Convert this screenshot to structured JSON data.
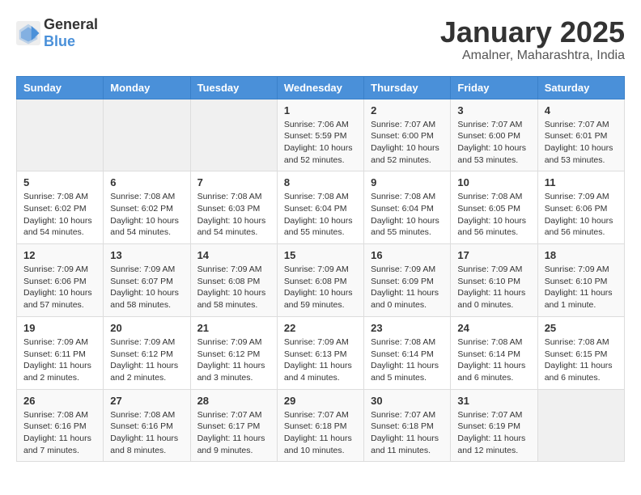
{
  "header": {
    "logo": {
      "text_general": "General",
      "text_blue": "Blue"
    },
    "title": "January 2025",
    "subtitle": "Amalner, Maharashtra, India"
  },
  "weekdays": [
    "Sunday",
    "Monday",
    "Tuesday",
    "Wednesday",
    "Thursday",
    "Friday",
    "Saturday"
  ],
  "weeks": [
    [
      {
        "day": "",
        "info": ""
      },
      {
        "day": "",
        "info": ""
      },
      {
        "day": "",
        "info": ""
      },
      {
        "day": "1",
        "info": "Sunrise: 7:06 AM\nSunset: 5:59 PM\nDaylight: 10 hours\nand 52 minutes."
      },
      {
        "day": "2",
        "info": "Sunrise: 7:07 AM\nSunset: 6:00 PM\nDaylight: 10 hours\nand 52 minutes."
      },
      {
        "day": "3",
        "info": "Sunrise: 7:07 AM\nSunset: 6:00 PM\nDaylight: 10 hours\nand 53 minutes."
      },
      {
        "day": "4",
        "info": "Sunrise: 7:07 AM\nSunset: 6:01 PM\nDaylight: 10 hours\nand 53 minutes."
      }
    ],
    [
      {
        "day": "5",
        "info": "Sunrise: 7:08 AM\nSunset: 6:02 PM\nDaylight: 10 hours\nand 54 minutes."
      },
      {
        "day": "6",
        "info": "Sunrise: 7:08 AM\nSunset: 6:02 PM\nDaylight: 10 hours\nand 54 minutes."
      },
      {
        "day": "7",
        "info": "Sunrise: 7:08 AM\nSunset: 6:03 PM\nDaylight: 10 hours\nand 54 minutes."
      },
      {
        "day": "8",
        "info": "Sunrise: 7:08 AM\nSunset: 6:04 PM\nDaylight: 10 hours\nand 55 minutes."
      },
      {
        "day": "9",
        "info": "Sunrise: 7:08 AM\nSunset: 6:04 PM\nDaylight: 10 hours\nand 55 minutes."
      },
      {
        "day": "10",
        "info": "Sunrise: 7:08 AM\nSunset: 6:05 PM\nDaylight: 10 hours\nand 56 minutes."
      },
      {
        "day": "11",
        "info": "Sunrise: 7:09 AM\nSunset: 6:06 PM\nDaylight: 10 hours\nand 56 minutes."
      }
    ],
    [
      {
        "day": "12",
        "info": "Sunrise: 7:09 AM\nSunset: 6:06 PM\nDaylight: 10 hours\nand 57 minutes."
      },
      {
        "day": "13",
        "info": "Sunrise: 7:09 AM\nSunset: 6:07 PM\nDaylight: 10 hours\nand 58 minutes."
      },
      {
        "day": "14",
        "info": "Sunrise: 7:09 AM\nSunset: 6:08 PM\nDaylight: 10 hours\nand 58 minutes."
      },
      {
        "day": "15",
        "info": "Sunrise: 7:09 AM\nSunset: 6:08 PM\nDaylight: 10 hours\nand 59 minutes."
      },
      {
        "day": "16",
        "info": "Sunrise: 7:09 AM\nSunset: 6:09 PM\nDaylight: 11 hours\nand 0 minutes."
      },
      {
        "day": "17",
        "info": "Sunrise: 7:09 AM\nSunset: 6:10 PM\nDaylight: 11 hours\nand 0 minutes."
      },
      {
        "day": "18",
        "info": "Sunrise: 7:09 AM\nSunset: 6:10 PM\nDaylight: 11 hours\nand 1 minute."
      }
    ],
    [
      {
        "day": "19",
        "info": "Sunrise: 7:09 AM\nSunset: 6:11 PM\nDaylight: 11 hours\nand 2 minutes."
      },
      {
        "day": "20",
        "info": "Sunrise: 7:09 AM\nSunset: 6:12 PM\nDaylight: 11 hours\nand 2 minutes."
      },
      {
        "day": "21",
        "info": "Sunrise: 7:09 AM\nSunset: 6:12 PM\nDaylight: 11 hours\nand 3 minutes."
      },
      {
        "day": "22",
        "info": "Sunrise: 7:09 AM\nSunset: 6:13 PM\nDaylight: 11 hours\nand 4 minutes."
      },
      {
        "day": "23",
        "info": "Sunrise: 7:08 AM\nSunset: 6:14 PM\nDaylight: 11 hours\nand 5 minutes."
      },
      {
        "day": "24",
        "info": "Sunrise: 7:08 AM\nSunset: 6:14 PM\nDaylight: 11 hours\nand 6 minutes."
      },
      {
        "day": "25",
        "info": "Sunrise: 7:08 AM\nSunset: 6:15 PM\nDaylight: 11 hours\nand 6 minutes."
      }
    ],
    [
      {
        "day": "26",
        "info": "Sunrise: 7:08 AM\nSunset: 6:16 PM\nDaylight: 11 hours\nand 7 minutes."
      },
      {
        "day": "27",
        "info": "Sunrise: 7:08 AM\nSunset: 6:16 PM\nDaylight: 11 hours\nand 8 minutes."
      },
      {
        "day": "28",
        "info": "Sunrise: 7:07 AM\nSunset: 6:17 PM\nDaylight: 11 hours\nand 9 minutes."
      },
      {
        "day": "29",
        "info": "Sunrise: 7:07 AM\nSunset: 6:18 PM\nDaylight: 11 hours\nand 10 minutes."
      },
      {
        "day": "30",
        "info": "Sunrise: 7:07 AM\nSunset: 6:18 PM\nDaylight: 11 hours\nand 11 minutes."
      },
      {
        "day": "31",
        "info": "Sunrise: 7:07 AM\nSunset: 6:19 PM\nDaylight: 11 hours\nand 12 minutes."
      },
      {
        "day": "",
        "info": ""
      }
    ]
  ]
}
